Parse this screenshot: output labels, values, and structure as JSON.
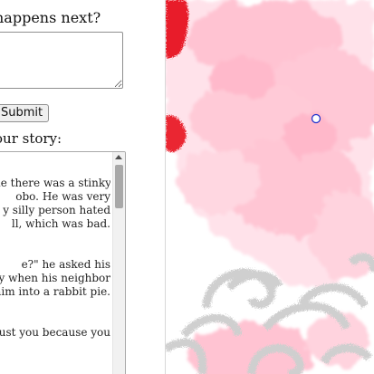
{
  "left_panel": {
    "prompt_label": "happens next?",
    "next_input_value": "",
    "submit_label": "Submit",
    "story_label": "our story:",
    "story_lines": [
      "",
      "ne there was a stinky",
      "obo. He was very",
      "y silly person hated",
      "ll, which was bad.",
      "",
      "",
      "e?\" he asked his",
      "y when his neighbor",
      "him into a rabbit pie.",
      "",
      "",
      "ust you because you",
      ""
    ]
  },
  "canvas": {
    "colors": {
      "pink": "#ffc6d4",
      "light_pink": "#ffe0e8",
      "red": "#ee2222",
      "gray": "#d7d7d7",
      "cursor": "#2233cc"
    }
  }
}
